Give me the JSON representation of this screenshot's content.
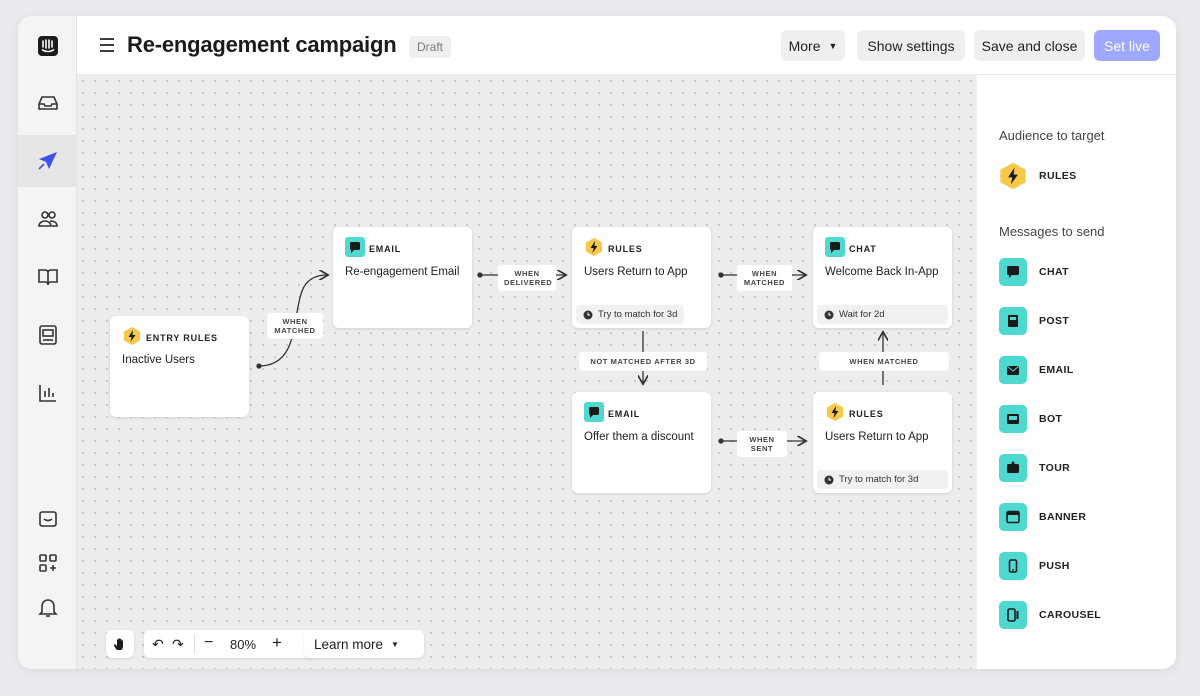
{
  "header": {
    "title": "Re-engagement campaign",
    "status_badge": "Draft",
    "more_label": "More",
    "show_settings_label": "Show settings",
    "save_close_label": "Save and close",
    "set_live_label": "Set live"
  },
  "nav": {
    "items": [
      "logo-icon",
      "inbox-icon",
      "outbound-icon",
      "contacts-icon",
      "articles-icon",
      "messenger-icon",
      "reports-icon",
      "conversation-icon",
      "apps-icon",
      "notifications-icon"
    ],
    "active": "outbound-icon"
  },
  "flow": {
    "entry": {
      "type": "ENTRY RULES",
      "title": "Inactive Users"
    },
    "email1": {
      "type": "EMAIL",
      "title": "Re-engagement Email"
    },
    "rules1": {
      "type": "RULES",
      "title": "Users Return to App",
      "footer": "Try to match for 3d"
    },
    "chat1": {
      "type": "CHAT",
      "title": "Welcome Back In-App",
      "footer": "Wait for 2d"
    },
    "email2": {
      "type": "EMAIL",
      "title": "Offer them a discount"
    },
    "rules2": {
      "type": "RULES",
      "title": "Users Return to App",
      "footer": "Try to match for 3d"
    },
    "edges": {
      "when_matched_1": "WHEN MATCHED",
      "when_delivered": "WHEN DELIVERED",
      "when_matched_2": "WHEN MATCHED",
      "not_matched": "NOT MATCHED AFTER 3D",
      "when_sent": "WHEN SENT",
      "when_matched_3": "WHEN MATCHED"
    }
  },
  "toolbar": {
    "zoom": "80%",
    "zoom_out": "−",
    "zoom_in": "+",
    "learn_more_label": "Learn more"
  },
  "panel": {
    "audience_heading": "Audience to target",
    "audience_items": [
      "RULES"
    ],
    "messages_heading": "Messages to send",
    "message_items": [
      "CHAT",
      "POST",
      "EMAIL",
      "BOT",
      "TOUR",
      "BANNER",
      "PUSH",
      "CAROUSEL"
    ]
  },
  "colors": {
    "accent": "#9ea8ff",
    "rules_badge": "#f7c948",
    "message_chip": "#4fd8d0",
    "nav_active_icon": "#3c52e8"
  }
}
